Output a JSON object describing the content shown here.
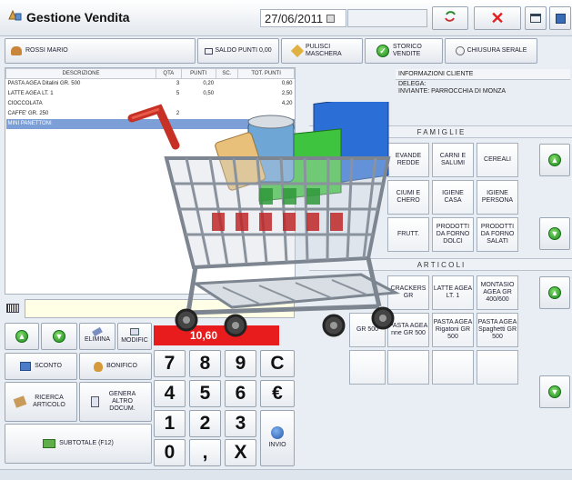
{
  "header": {
    "title": "Gestione Vendita",
    "date": "27/06/2011"
  },
  "toolbar": {
    "customer": "ROSSI MARIO",
    "saldo": "SALDO PUNTI 0,00",
    "pulisci": "PULISCI MASCHERA",
    "storico": "STORICO VENDITE",
    "chiusura": "CHIUSURA SERALE"
  },
  "table": {
    "headers": [
      "DESCRIZIONE",
      "QTA",
      "PUNTI",
      "SC.",
      "TOT. PUNTI"
    ],
    "rows": [
      [
        "PASTA AGEA Ditalini GR. 500",
        "3",
        "0,20",
        "",
        "0,60"
      ],
      [
        "LATTE AGEA LT. 1",
        "5",
        "0,50",
        "",
        "2,50"
      ],
      [
        "CIOCCOLATA",
        "",
        "",
        "",
        "4,20"
      ],
      [
        "CAFFE' GR. 250",
        "2",
        "",
        "",
        ""
      ],
      [
        "MINI PANETTONI",
        "",
        "",
        "",
        ""
      ]
    ]
  },
  "info": {
    "title": "INFORMAZIONI CLIENTE",
    "line1": "DELEGA:",
    "line2": "INVIANTE: PARROCCHIA DI MONZA"
  },
  "famiglie": {
    "title": "F A M I G L I E",
    "items": [
      "EVANDE REDDE",
      "CARNI E SALUMI",
      "CEREALI",
      "CIUMI E CHERO",
      "IGIENE CASA",
      "IGIENE PERSONA",
      "FRUTT.",
      "PRODOTTI DA FORNO DOLCI",
      "PRODOTTI DA FORNO SALATI"
    ]
  },
  "articoli": {
    "title": "A R T I C O L I",
    "items": [
      "CRACKERS GR",
      "LATTE AGEA LT. 1",
      "MONTASIO AGEA GR 400/600",
      "PASTA AGEA nne GR 500",
      "PASTA AGEA Rigatoni GR 500",
      "PASTA AGEA Spaghetti GR 500",
      "GR 500"
    ]
  },
  "actions": {
    "elimina": "ELIMINA",
    "modific": "MODIFIC",
    "total": "10,60",
    "sconto": "SCONTO",
    "bonifico": "BONIFICO",
    "ricerca": "RICERCA ARTICOLO",
    "genera": "GENERA ALTRO DOCUM.",
    "subtotale": "SUBTOTALE (F12)",
    "invio": "INVIO"
  },
  "keypad": [
    "7",
    "8",
    "9",
    "C",
    "4",
    "5",
    "6",
    "€",
    "1",
    "2",
    "3",
    "0",
    ",",
    "X"
  ],
  "colors": {
    "accent": "#d93030",
    "green": "#2aa52a",
    "selected_row": "#7b9fd6",
    "total_bg": "#e81c1c"
  }
}
